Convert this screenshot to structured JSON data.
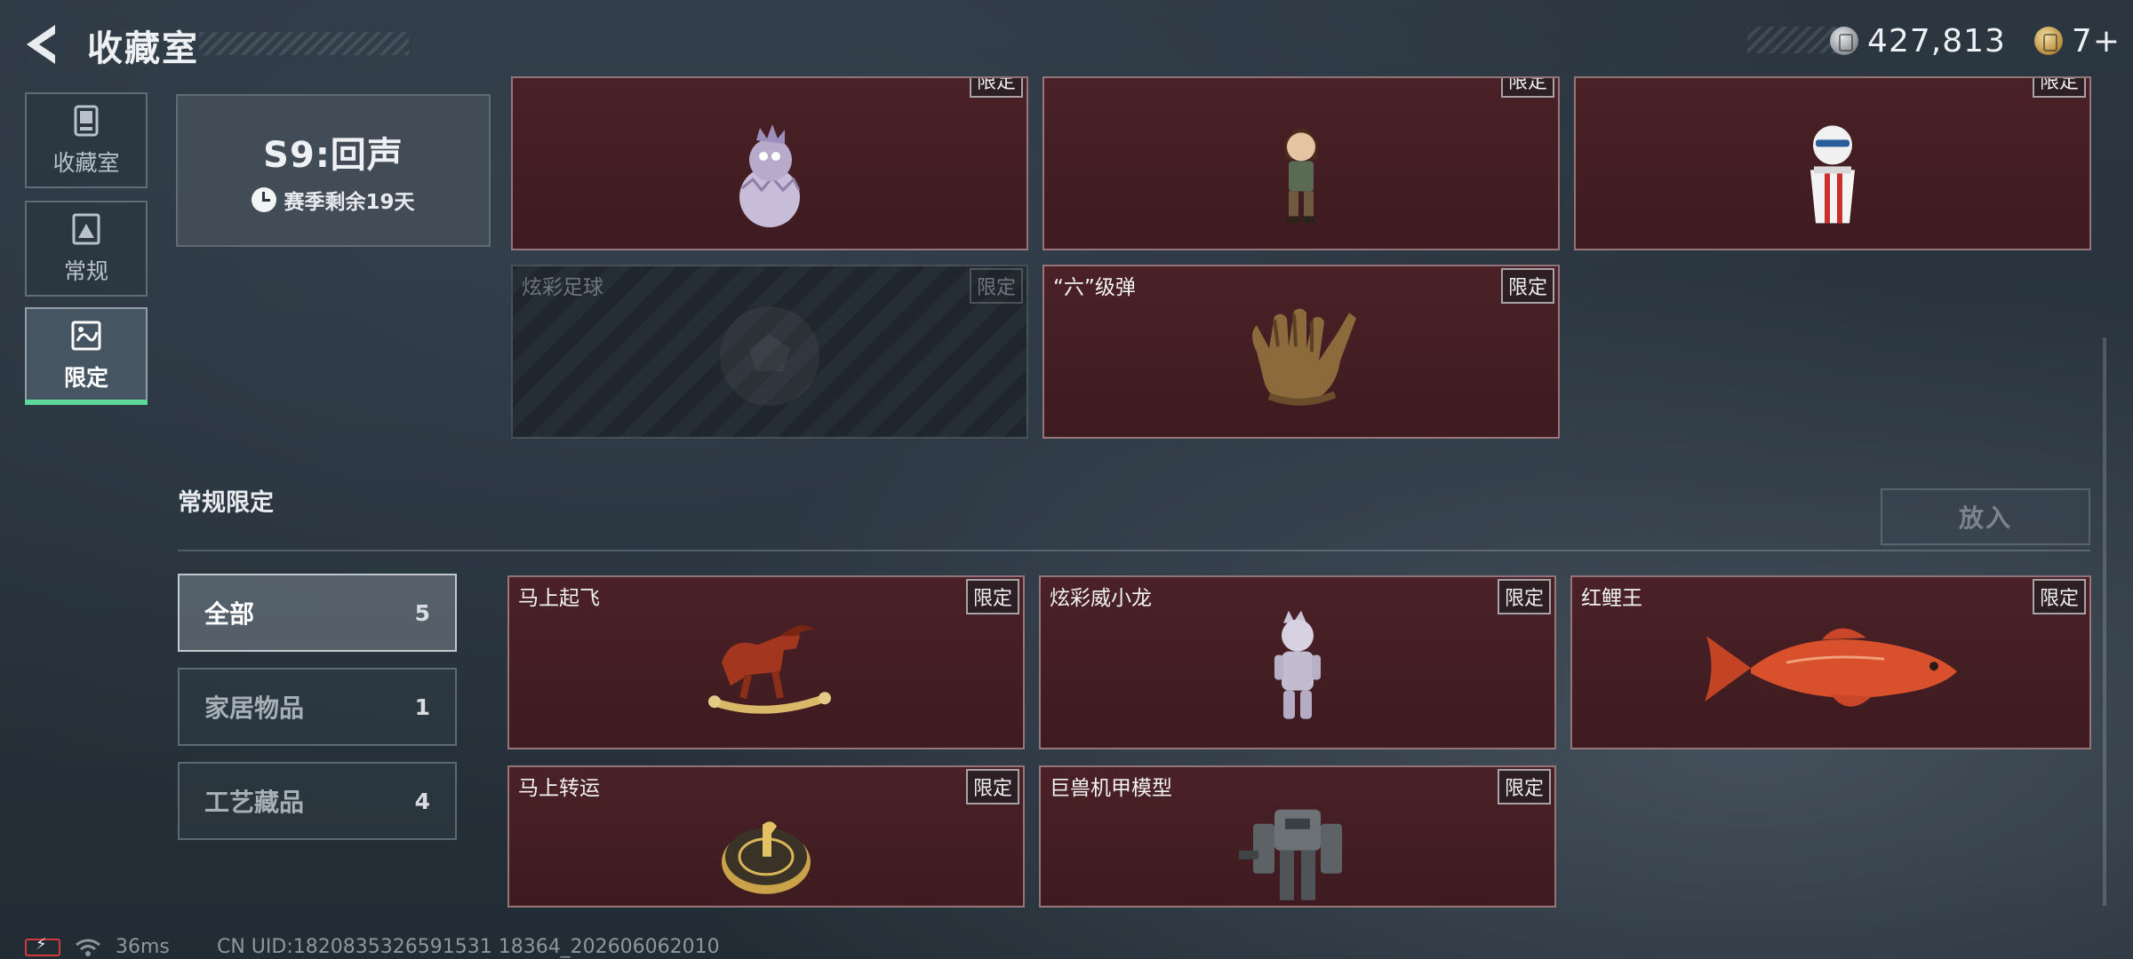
{
  "header": {
    "title": "收藏室",
    "currency_silver": "427,813",
    "currency_gold": "7+"
  },
  "sidebar": {
    "items": [
      {
        "label": "收藏室"
      },
      {
        "label": "常规"
      },
      {
        "label": "限定"
      }
    ],
    "active_index": 2
  },
  "season": {
    "title": "S9:回声",
    "remaining": "赛季剩余19天"
  },
  "season_items": [
    {
      "name": "",
      "badge": "限定"
    },
    {
      "name": "",
      "badge": "限定"
    },
    {
      "name": "",
      "badge": "限定"
    },
    {
      "name": "炫彩足球",
      "badge": "限定",
      "locked": true
    },
    {
      "name": "“六”级弹",
      "badge": "限定"
    }
  ],
  "section": {
    "title": "常规限定",
    "put_button": "放入"
  },
  "filters": [
    {
      "label": "全部",
      "count": "5",
      "active": true
    },
    {
      "label": "家居物品",
      "count": "1"
    },
    {
      "label": "工艺藏品",
      "count": "4"
    }
  ],
  "regular_items": [
    {
      "name": "马上起飞",
      "badge": "限定"
    },
    {
      "name": "炫彩威小龙",
      "badge": "限定"
    },
    {
      "name": "红鲤王",
      "badge": "限定"
    },
    {
      "name": "马上转运",
      "badge": "限定"
    },
    {
      "name": "巨兽机甲模型",
      "badge": "限定"
    }
  ],
  "status": {
    "ping": "36ms",
    "uid": "CN UID:1820835326591531 18364_202606062010"
  },
  "colors": {
    "card_bg": "#45202a",
    "active_accent": "#5fd69a"
  }
}
